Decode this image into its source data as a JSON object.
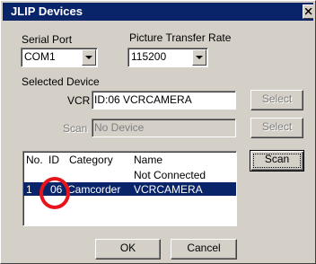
{
  "window": {
    "title": "JLIP Devices"
  },
  "serial_port": {
    "label": "Serial Port",
    "value": "COM1"
  },
  "transfer_rate": {
    "label": "Picture Transfer Rate",
    "value": "115200"
  },
  "selected_device": {
    "label": "Selected Device",
    "vcr_label": "VCR",
    "vcr_value": "ID:06 VCRCAMERA",
    "scan_label": "Scan",
    "scan_value": "No Device",
    "select_label": "Select"
  },
  "device_list": {
    "columns": [
      "No.",
      "ID",
      "Category",
      "Name"
    ],
    "rows": [
      {
        "no": "",
        "id": "",
        "category": "",
        "name": "Not Connected",
        "selected": false
      },
      {
        "no": "1",
        "id": "06",
        "category": "Camcorder",
        "name": "VCRCAMERA",
        "selected": true
      }
    ]
  },
  "buttons": {
    "scan": "Scan",
    "ok": "OK",
    "cancel": "Cancel"
  },
  "colors": {
    "titlebar": "#0a246a",
    "selection": "#0a246a",
    "annotation": "#e8141c"
  }
}
